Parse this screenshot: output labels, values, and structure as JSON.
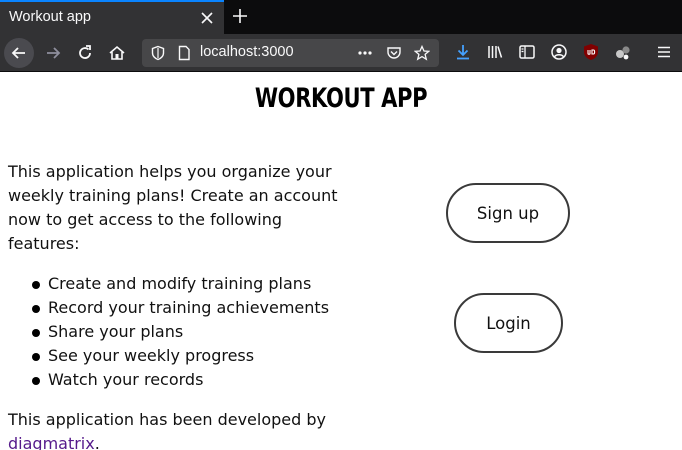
{
  "browser": {
    "tab_title": "Workout app",
    "url": "localhost:3000"
  },
  "page": {
    "title": "WORKOUT APP",
    "intro": "This application helps you organize your weekly training plans! Create an account now to get access to the following features:",
    "features": [
      "Create and modify training plans",
      "Record your training achievements",
      "Share your plans",
      "See your weekly progress",
      "Watch your records"
    ],
    "developed_prefix": "This application has been developed by",
    "developer_link": "diagmatrix",
    "developed_suffix": ".",
    "signup_label": "Sign up",
    "login_label": "Login"
  },
  "colors": {
    "tab_accent": "#0a84ff",
    "chrome_bg": "#323234",
    "link": "#551a8b"
  }
}
